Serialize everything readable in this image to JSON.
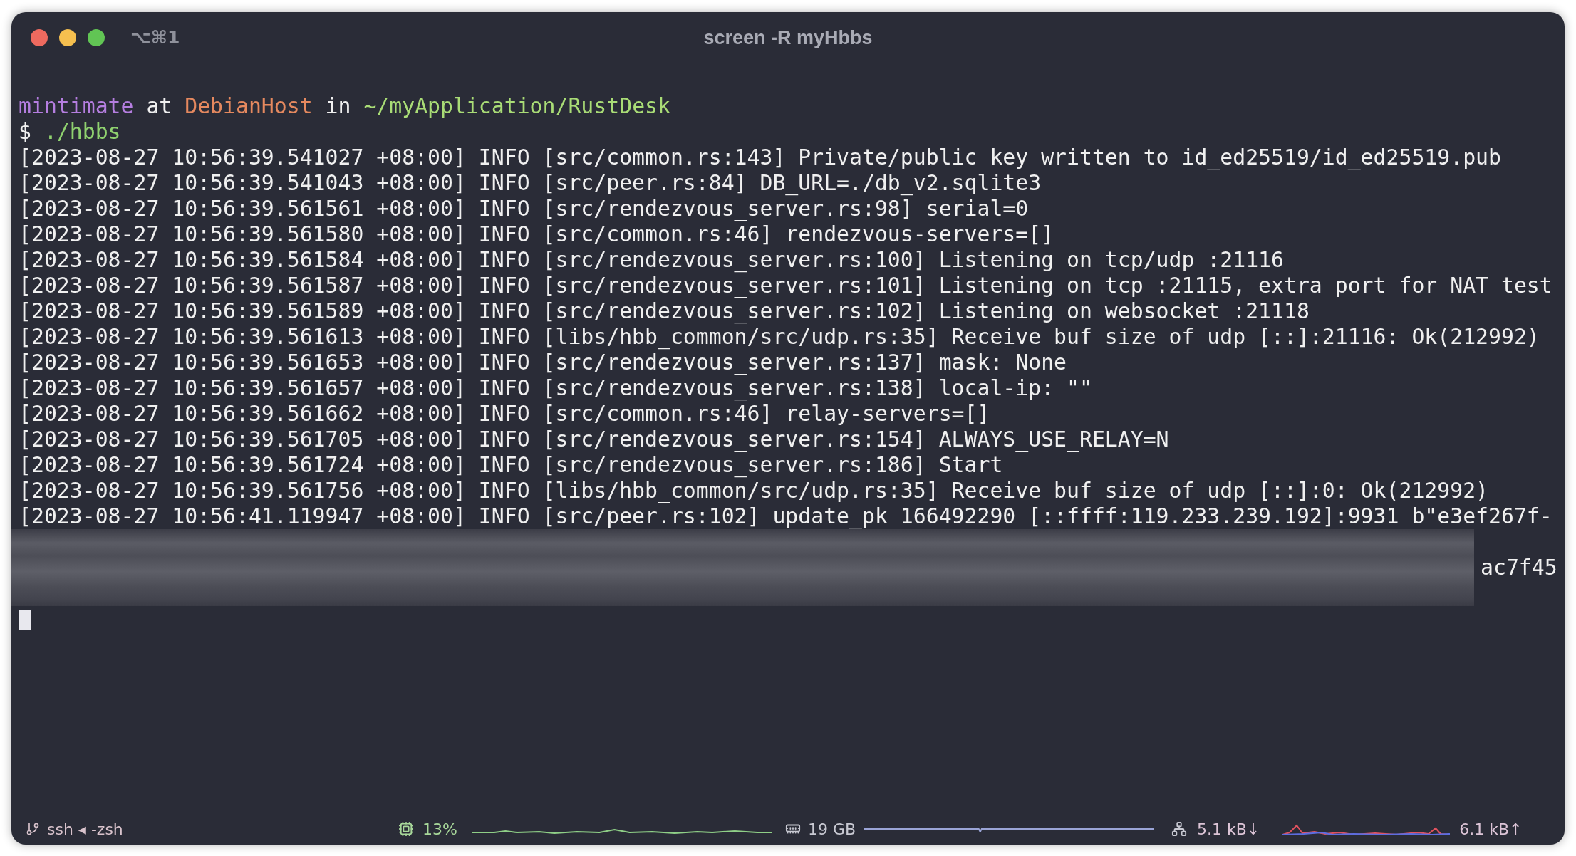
{
  "window": {
    "shortcut": "⌥⌘1",
    "title": "screen -R myHbbs"
  },
  "terminal": {
    "prompt": [
      {
        "kind": "user",
        "text": "mintimate"
      },
      {
        "kind": "plain",
        "text": "at"
      },
      {
        "kind": "host",
        "text": "DebianHost"
      },
      {
        "kind": "plain",
        "text": "in"
      },
      {
        "kind": "path",
        "text": "~/myApplication/RustDesk"
      }
    ],
    "command": [
      {
        "kind": "symbol",
        "text": "$"
      },
      {
        "kind": "command",
        "text": "./hbbs"
      }
    ],
    "log_lines": [
      "[2023-08-27 10:56:39.541027 +08:00] INFO [src/common.rs:143] Private/public key written to id_ed25519/id_ed25519.pub",
      "[2023-08-27 10:56:39.541043 +08:00] INFO [src/peer.rs:84] DB_URL=./db_v2.sqlite3",
      "[2023-08-27 10:56:39.561561 +08:00] INFO [src/rendezvous_server.rs:98] serial=0",
      "[2023-08-27 10:56:39.561580 +08:00] INFO [src/common.rs:46] rendezvous-servers=[]",
      "[2023-08-27 10:56:39.561584 +08:00] INFO [src/rendezvous_server.rs:100] Listening on tcp/udp :21116",
      "[2023-08-27 10:56:39.561587 +08:00] INFO [src/rendezvous_server.rs:101] Listening on tcp :21115, extra port for NAT test",
      "[2023-08-27 10:56:39.561589 +08:00] INFO [src/rendezvous_server.rs:102] Listening on websocket :21118",
      "[2023-08-27 10:56:39.561613 +08:00] INFO [libs/hbb_common/src/udp.rs:35] Receive buf size of udp [::]:21116: Ok(212992)",
      "[2023-08-27 10:56:39.561653 +08:00] INFO [src/rendezvous_server.rs:137] mask: None",
      "[2023-08-27 10:56:39.561657 +08:00] INFO [src/rendezvous_server.rs:138] local-ip: \"\"",
      "[2023-08-27 10:56:39.561662 +08:00] INFO [src/common.rs:46] relay-servers=[]",
      "[2023-08-27 10:56:39.561705 +08:00] INFO [src/rendezvous_server.rs:154] ALWAYS_USE_RELAY=N",
      "[2023-08-27 10:56:39.561724 +08:00] INFO [src/rendezvous_server.rs:186] Start",
      "[2023-08-27 10:56:39.561756 +08:00] INFO [libs/hbb_common/src/udp.rs:35] Receive buf size of udp [::]:0: Ok(212992)",
      "[2023-08-27 10:56:41.119947 +08:00] INFO [src/peer.rs:102] update_pk 166492290 [::ffff:119.233.239.192]:9931 b\"e3ef267f-"
    ],
    "redacted_tail": "ac7f45"
  },
  "status_bar": {
    "session": "ssh ◂ -zsh",
    "cpu": "13%",
    "memory": "19 GB",
    "download": "5.1 kB↓",
    "upload": "6.1 kB↑"
  }
}
